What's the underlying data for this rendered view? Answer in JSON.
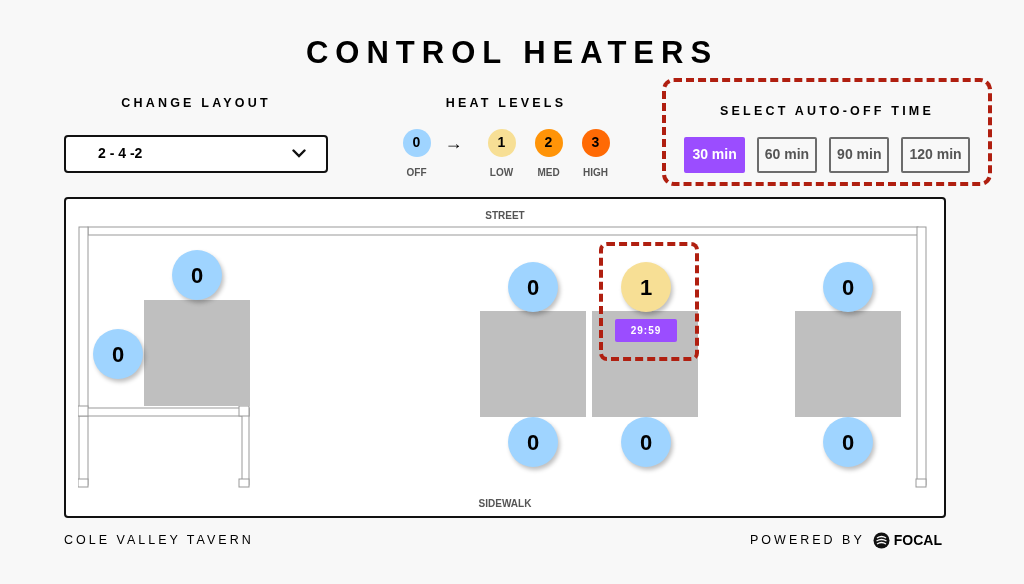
{
  "title": "CONTROL HEATERS",
  "layout": {
    "label": "CHANGE LAYOUT",
    "value": "2 - 4 -2"
  },
  "heat_levels": {
    "label": "HEAT LEVELS",
    "arrow": "→",
    "levels": [
      {
        "value": "0",
        "label": "OFF",
        "color": "#9fd4ff"
      },
      {
        "value": "1",
        "label": "LOW",
        "color": "#f7df95"
      },
      {
        "value": "2",
        "label": "MED",
        "color": "#ff9408"
      },
      {
        "value": "3",
        "label": "HIGH",
        "color": "#ff6a05"
      }
    ]
  },
  "auto_off": {
    "label": "SELECT AUTO-OFF TIME",
    "highlighted": true,
    "options": [
      {
        "label": "30 min",
        "selected": true
      },
      {
        "label": "60 min",
        "selected": false
      },
      {
        "label": "90 min",
        "selected": false
      },
      {
        "label": "120 min",
        "selected": false
      }
    ]
  },
  "floor_plan": {
    "top_label": "STREET",
    "bottom_label": "SIDEWALK",
    "heaters": [
      {
        "heat": "0",
        "highlighted": false
      },
      {
        "heat": "0",
        "highlighted": false
      },
      {
        "heat": "0",
        "highlighted": false
      },
      {
        "heat": "1",
        "highlighted": true,
        "timer": "29:59"
      },
      {
        "heat": "0",
        "highlighted": false
      },
      {
        "heat": "0",
        "highlighted": false
      },
      {
        "heat": "0",
        "highlighted": false
      },
      {
        "heat": "0",
        "highlighted": false
      }
    ]
  },
  "footer": {
    "venue": "COLE VALLEY TAVERN",
    "powered_by": "POWERED BY",
    "brand": "FOCAL"
  }
}
